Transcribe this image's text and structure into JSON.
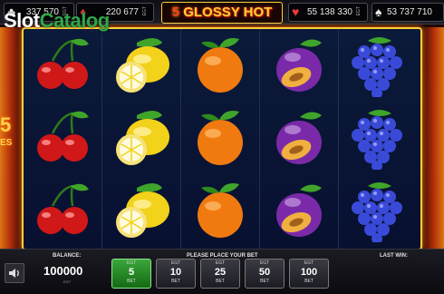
{
  "top_bar": {
    "jackpots": [
      {
        "suit": "♣",
        "value": "337 570",
        "suit_color": "#e8e8e8"
      },
      {
        "suit": "♦",
        "value": "220 677",
        "suit_color": "#e83a3a"
      },
      {
        "suit": "♥",
        "value": "55 138 330",
        "suit_color": "#e83a3a"
      },
      {
        "suit": "♠",
        "value": "53 737 710",
        "suit_color": "#e8e8e8"
      }
    ],
    "egt_tag": "EGT",
    "logo_number": "5",
    "logo_text": "GLOSSY HOT"
  },
  "watermark": {
    "part1": "Slot",
    "part2": "Catalog"
  },
  "side_promo": {
    "number": "5",
    "text": "ES"
  },
  "reels": [
    [
      "cherry",
      "cherry",
      "cherry"
    ],
    [
      "lemon",
      "lemon",
      "lemon"
    ],
    [
      "orange",
      "orange",
      "orange"
    ],
    [
      "plum",
      "plum",
      "plum"
    ],
    [
      "grapes",
      "grapes",
      "grapes"
    ]
  ],
  "bottom": {
    "balance_label": "BALANCE:",
    "balance_value": "100000",
    "balance_egt": "EGT",
    "place_bet_label": "PLEASE PLACE YOUR BET",
    "last_win_label": "LAST WIN:",
    "bets": [
      {
        "egt": "EGT",
        "value": "5",
        "bet": "BET",
        "selected": true
      },
      {
        "egt": "EGT",
        "value": "10",
        "bet": "BET",
        "selected": false
      },
      {
        "egt": "EGT",
        "value": "25",
        "bet": "BET",
        "selected": false
      },
      {
        "egt": "EGT",
        "value": "50",
        "bet": "BET",
        "selected": false
      },
      {
        "egt": "EGT",
        "value": "100",
        "bet": "BET",
        "selected": false
      }
    ]
  },
  "colors": {
    "frame": "#ffcf3a",
    "selected_bet": "#2e9a2e",
    "reel_bg": "#0b1a3a"
  }
}
